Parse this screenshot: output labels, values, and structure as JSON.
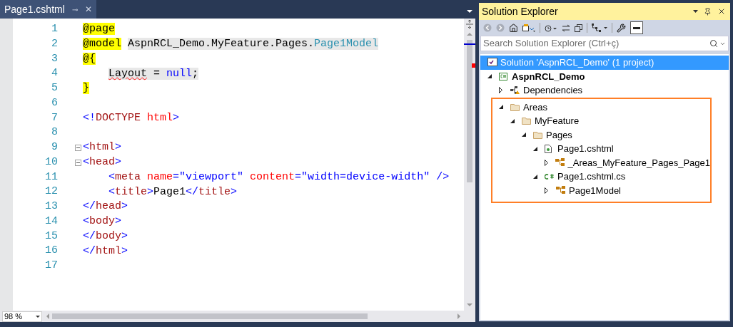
{
  "editor": {
    "tab": {
      "label": "Page1.cshtml",
      "selected": true,
      "pin": "⊸",
      "close": "✕"
    },
    "lines": [
      {
        "number": "1",
        "fold": false,
        "indented": false,
        "tokens": [
          {
            "kind": "razor",
            "text": "@page"
          }
        ]
      },
      {
        "number": "2",
        "fold": false,
        "indented": false,
        "tokens": [
          {
            "kind": "razor",
            "text": "@model"
          },
          {
            "kind": "text",
            "text": "AspnRCL_Demo.MyFeature.Pages.",
            "shaded": true,
            "gap": true
          },
          {
            "kind": "type",
            "text": "Page1Model",
            "shaded": true
          }
        ]
      },
      {
        "number": "3",
        "fold": false,
        "indented": false,
        "tokens": [
          {
            "kind": "razor",
            "text": "@{"
          }
        ]
      },
      {
        "number": "4",
        "fold": false,
        "indented": true,
        "tokens": [
          {
            "kind": "text",
            "text": "Layout",
            "shaded": true,
            "squiggle": true
          },
          {
            "kind": "text",
            "text": " = ",
            "shaded": true
          },
          {
            "kind": "keyword",
            "text": "null",
            "shaded": true
          },
          {
            "kind": "text",
            "text": ";",
            "shaded": true
          }
        ]
      },
      {
        "number": "5",
        "fold": false,
        "indented": false,
        "tokens": [
          {
            "kind": "razor",
            "text": "}"
          }
        ]
      },
      {
        "number": "6",
        "fold": false
      },
      {
        "number": "7",
        "fold": false,
        "indented": false,
        "tokens": [
          {
            "kind": "delim",
            "text": "<!"
          },
          {
            "kind": "tag",
            "text": "DOCTYPE"
          },
          {
            "kind": "attr",
            "text": "html",
            "gap": true
          },
          {
            "kind": "delim",
            "text": ">"
          }
        ]
      },
      {
        "number": "8",
        "fold": false
      },
      {
        "number": "9",
        "fold": true,
        "indented": false,
        "tokens": [
          {
            "kind": "delim",
            "text": "<"
          },
          {
            "kind": "tag",
            "text": "html"
          },
          {
            "kind": "delim",
            "text": ">"
          }
        ]
      },
      {
        "number": "10",
        "fold": true,
        "indented": false,
        "tokens": [
          {
            "kind": "delim",
            "text": "<"
          },
          {
            "kind": "tag",
            "text": "head"
          },
          {
            "kind": "delim",
            "text": ">"
          }
        ]
      },
      {
        "number": "11",
        "fold": false,
        "indented": true,
        "tokens": [
          {
            "kind": "delim",
            "text": "<"
          },
          {
            "kind": "tag",
            "text": "meta"
          },
          {
            "kind": "attr",
            "text": "name",
            "gap": true
          },
          {
            "kind": "delim",
            "text": "="
          },
          {
            "kind": "value",
            "text": "\"viewport\""
          },
          {
            "kind": "attr",
            "text": "content",
            "gap": true
          },
          {
            "kind": "delim",
            "text": "="
          },
          {
            "kind": "value",
            "text": "\"width=device-width\""
          },
          {
            "kind": "delim",
            "text": "/>",
            "gap": true
          }
        ]
      },
      {
        "number": "12",
        "fold": false,
        "indented": true,
        "tokens": [
          {
            "kind": "delim",
            "text": "<"
          },
          {
            "kind": "tag",
            "text": "title"
          },
          {
            "kind": "delim",
            "text": ">"
          },
          {
            "kind": "text",
            "text": "Page1"
          },
          {
            "kind": "delim",
            "text": "</"
          },
          {
            "kind": "tag",
            "text": "title"
          },
          {
            "kind": "delim",
            "text": ">"
          }
        ]
      },
      {
        "number": "13",
        "fold": false,
        "indented": false,
        "tokens": [
          {
            "kind": "delim",
            "text": "</"
          },
          {
            "kind": "tag",
            "text": "head"
          },
          {
            "kind": "delim",
            "text": ">"
          }
        ]
      },
      {
        "number": "14",
        "fold": false,
        "indented": false,
        "tokens": [
          {
            "kind": "delim",
            "text": "<"
          },
          {
            "kind": "tag",
            "text": "body"
          },
          {
            "kind": "delim",
            "text": ">"
          }
        ]
      },
      {
        "number": "15",
        "fold": false,
        "indented": false,
        "tokens": [
          {
            "kind": "delim",
            "text": "</"
          },
          {
            "kind": "tag",
            "text": "body"
          },
          {
            "kind": "delim",
            "text": ">"
          }
        ]
      },
      {
        "number": "16",
        "fold": false,
        "indented": false,
        "tokens": [
          {
            "kind": "delim",
            "text": "</"
          },
          {
            "kind": "tag",
            "text": "html"
          },
          {
            "kind": "delim",
            "text": ">"
          }
        ]
      },
      {
        "number": "17",
        "fold": false
      }
    ],
    "zoom": "98 %"
  },
  "solution_explorer": {
    "title": "Solution Explorer",
    "search": {
      "placeholder": "Search Solution Explorer (Ctrl+ç)"
    },
    "solution": {
      "label": "Solution 'AspnRCL_Demo' (1 project)",
      "selected": true
    },
    "tree": [
      {
        "kind": "project",
        "label": "AspnRCL_Demo",
        "bold": true,
        "expanded": true,
        "selected": false,
        "children": [
          {
            "kind": "dependencies",
            "label": "Dependencies",
            "expanded": false,
            "selected": false
          },
          {
            "kind": "folder",
            "label": "Areas",
            "expanded": true,
            "selected": false,
            "highlighted": true,
            "children": [
              {
                "kind": "folder",
                "label": "MyFeature",
                "expanded": true,
                "selected": false,
                "children": [
                  {
                    "kind": "folder",
                    "label": "Pages",
                    "expanded": true,
                    "selected": false,
                    "children": [
                      {
                        "kind": "razor",
                        "label": "Page1.cshtml",
                        "expanded": true,
                        "selected": false,
                        "children": [
                          {
                            "kind": "class",
                            "label": "_Areas_MyFeature_Pages_Page1",
                            "expanded": false,
                            "selected": false
                          }
                        ]
                      },
                      {
                        "kind": "csharp",
                        "label": "Page1.cshtml.cs",
                        "expanded": true,
                        "selected": false,
                        "children": [
                          {
                            "kind": "class",
                            "label": "Page1Model",
                            "expanded": false,
                            "selected": false
                          }
                        ]
                      }
                    ]
                  }
                ]
              }
            ]
          }
        ]
      }
    ]
  }
}
